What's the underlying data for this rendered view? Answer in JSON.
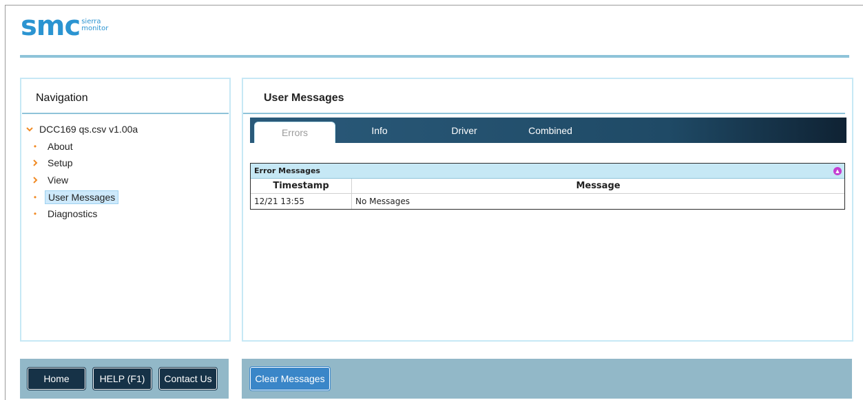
{
  "logo": {
    "mark": "SMC",
    "sub1": "sierra",
    "sub2": "monitor"
  },
  "navigation": {
    "title": "Navigation",
    "root": "DCC169 qs.csv v1.00a",
    "items": [
      {
        "label": "About",
        "type": "leaf"
      },
      {
        "label": "Setup",
        "type": "folder"
      },
      {
        "label": "View",
        "type": "folder"
      },
      {
        "label": "User Messages",
        "type": "leaf",
        "selected": true
      },
      {
        "label": "Diagnostics",
        "type": "leaf"
      }
    ]
  },
  "main": {
    "title": "User Messages",
    "tabs": [
      {
        "label": "Errors",
        "active": true
      },
      {
        "label": "Info"
      },
      {
        "label": "Driver"
      },
      {
        "label": "Combined"
      }
    ],
    "table": {
      "caption": "Error Messages",
      "headers": [
        "Timestamp",
        "Message"
      ],
      "rows": [
        [
          "12/21 13:55",
          "No Messages"
        ]
      ]
    }
  },
  "footer": {
    "home": "Home",
    "help": "HELP (F1)",
    "contact": "Contact Us",
    "clear": "Clear Messages"
  },
  "colors": {
    "accent": "#2b94d1",
    "tree_icon": "#f08a24",
    "dark_button": "#163247",
    "blue_button": "#3a86c8",
    "footer_bar": "#92b8c8"
  }
}
